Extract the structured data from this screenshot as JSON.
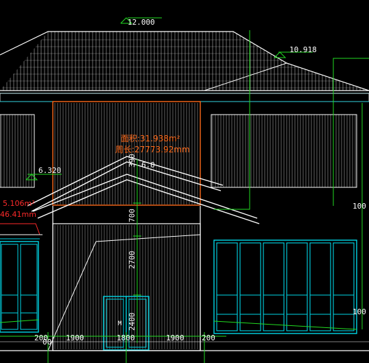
{
  "colors": {
    "background": "#000000",
    "wall": "#ffffff",
    "cyan": "#00d8e8",
    "green": "#22dd22",
    "orange": "#ff6a1a",
    "red": "#ff2a2a"
  },
  "level_marks": {
    "ridge": "12.000",
    "secondary": "10.918",
    "canopy": "6.320"
  },
  "area_tag_main": {
    "area": "面积:31.938m²",
    "perimeter": "周长:27773.92mm"
  },
  "area_tag_left": {
    "area": "5.106m²",
    "perimeter": "46.41mm"
  },
  "vertical_dims": {
    "d_upper": "390",
    "d_700": "700",
    "d_2700": "2700",
    "d_door": "2400"
  },
  "angle_note": "6.0",
  "horizontal_dims": {
    "left_edge": "200",
    "left_bay": "1900",
    "door_bay": "1800",
    "right_bay": "1900",
    "right_edge": "200",
    "axis": "00"
  },
  "right_edge_marks": {
    "upper": "100",
    "lower": "100"
  },
  "door_label": "M"
}
